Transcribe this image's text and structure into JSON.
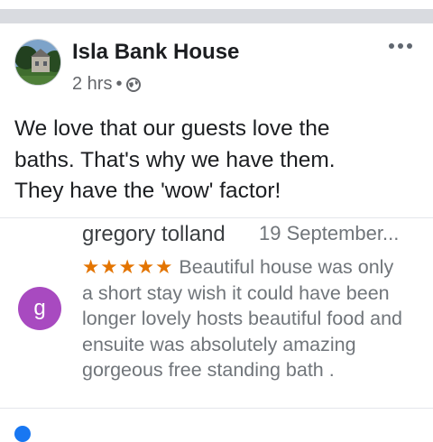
{
  "post": {
    "page_name": "Isla Bank House",
    "time": "2 hrs",
    "separator": "•",
    "text": "We love that our guests love the\nbaths. That's why we have them.\nThey have the 'wow' factor!"
  },
  "review": {
    "reviewer_initial": "g",
    "reviewer_name": "gregory tolland",
    "date": "19 September...",
    "stars": "★★★★★",
    "text": "Beautiful house was only a short stay wish it could have been longer lovely hosts beautiful food and ensuite was absolutely amazing gorgeous free standing bath ."
  },
  "colors": {
    "reviewer_avatar": "#a84ac0",
    "stars": "#e37400",
    "reaction": "#1877f2"
  },
  "icons": [
    "globe-icon",
    "more-options-icon",
    "like-reaction-icon"
  ]
}
